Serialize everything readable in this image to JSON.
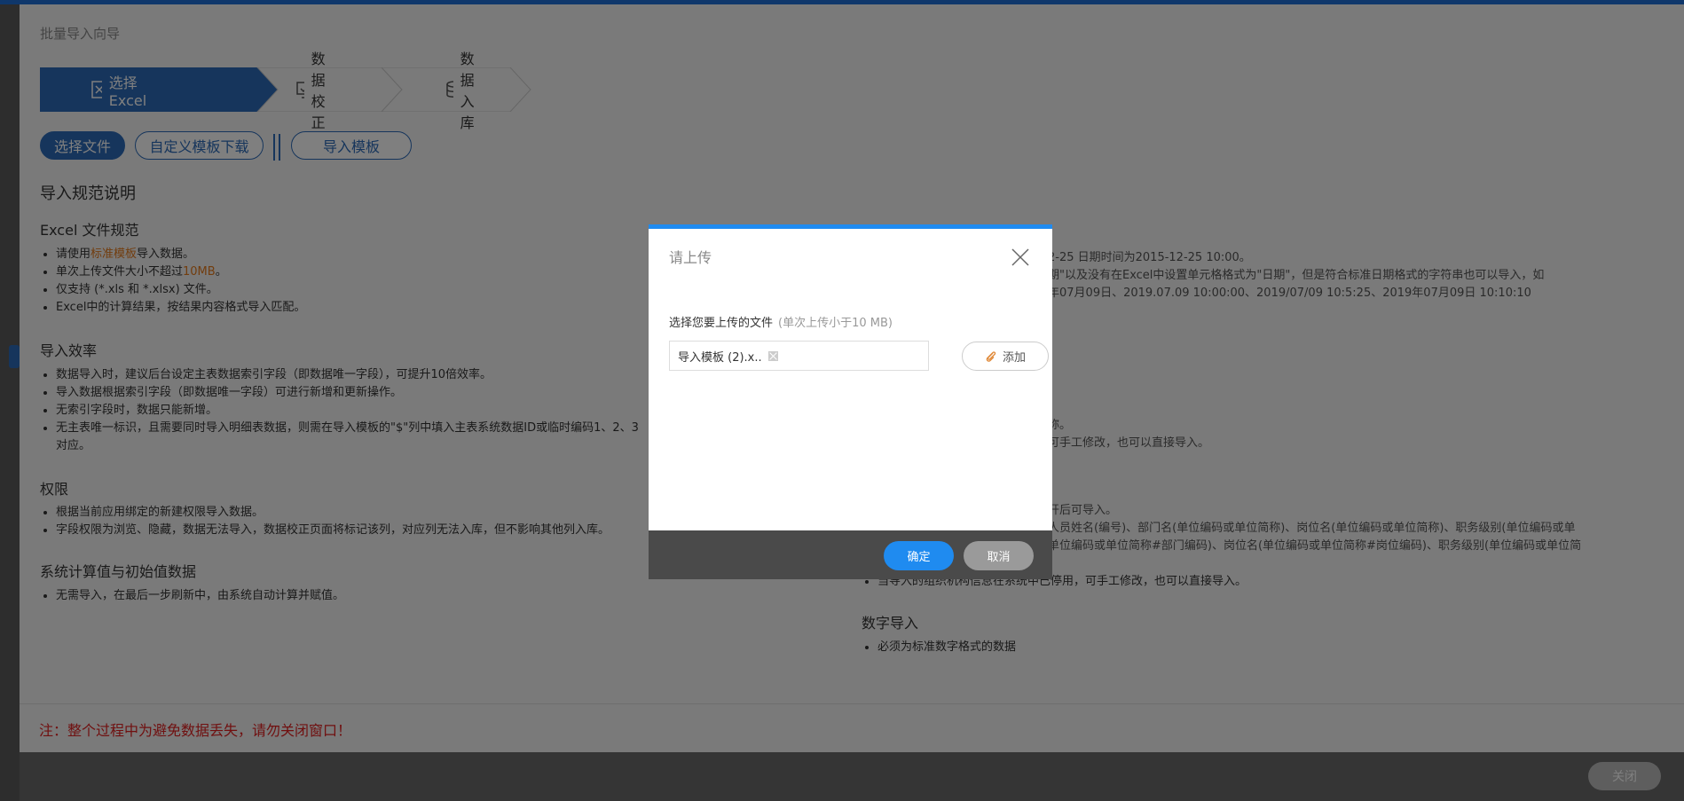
{
  "wizard": {
    "title": "批量导入向导",
    "steps": [
      {
        "label": "选择Excel",
        "active": true
      },
      {
        "label": "数据校正",
        "active": false
      },
      {
        "label": "数据入库",
        "active": false
      }
    ],
    "buttons": {
      "select_file": "选择文件",
      "custom_template": "自定义模板下载",
      "import_template": "导入模板"
    }
  },
  "left": {
    "heading": "导入规范说明",
    "excel_spec": {
      "title": "Excel 文件规范",
      "item1_pre": "请使用",
      "item1_link": "标准模板",
      "item1_post": "导入数据。",
      "item2_pre": "单次上传文件大小不超过",
      "item2_size": "10MB",
      "item2_post": "。",
      "item3": "仅支持 (*.xls 和 *.xlsx) 文件。",
      "item4": "Excel中的计算结果，按结果内容格式导入匹配。"
    },
    "efficiency": {
      "title": "导入效率",
      "items": [
        "数据导入时，建议后台设定主表数据索引字段（即数据唯一字段），可提升10倍效率。",
        "导入数据根据索引字段（即数据唯一字段）可进行新增和更新操作。",
        "无索引字段时，数据只能新增。",
        "无主表唯一标识，且需要同时导入明细表数据，则需在导入模板的\"$\"列中填入主表系统数据ID或临时编码1、2、3",
        "对应。"
      ]
    },
    "permission": {
      "title": "权限",
      "items": [
        "根据当前应用绑定的新建权限导入数据。",
        "字段权限为浏览、隐藏，数据无法导入，数据校正页面将标记该列，对应列无法入库，但不影响其他列入库。"
      ]
    },
    "system": {
      "title": "系统计算值与初始值数据",
      "items": [
        "无需导入，在最后一步刷新中，由系统自动计算并赋值。"
      ]
    }
  },
  "right": {
    "date_lines": [
      "2-25 日期时间为2015-12-25 10:00。",
      "期\"以及没有在Excel中设置单元格格式为\"日期\"，但是符合标准日期格式的字符串也可以导入，如",
      "年07月09日、2019.07.09 10:00:00、2019/07/09 10:5:25、2019年07月09日 10:10:10"
    ],
    "mid_lines": [
      "称。",
      "可手工修改，也可以直接导入。"
    ],
    "org_lines": [
      "开后可导入。",
      "人员姓名(编号)、部门名(单位编码或单位简称)、岗位名(单位编码或单位简称)、职务级别(单位编码或单",
      "单位编码或单位简称#部门编码)、岗位名(单位编码或单位简称#岗位编码)、职务级别(单位编码或单位简",
      "当导入的组织机构信息在系统中已停用，可手工修改，也可以直接导入。"
    ],
    "number": {
      "title": "数字导入",
      "items": [
        "必须为标准数字格式的数据"
      ]
    }
  },
  "warning": "注：整个过程中为避免数据丢失，请勿关闭窗口！",
  "footer": {
    "close": "关闭"
  },
  "dialog": {
    "title": "请上传",
    "label": "选择您要上传的文件",
    "hint": "(单次上传小于10 MB)",
    "file_name": "导入模板 (2).x..",
    "add": "添加",
    "ok": "确定",
    "cancel": "取消"
  }
}
